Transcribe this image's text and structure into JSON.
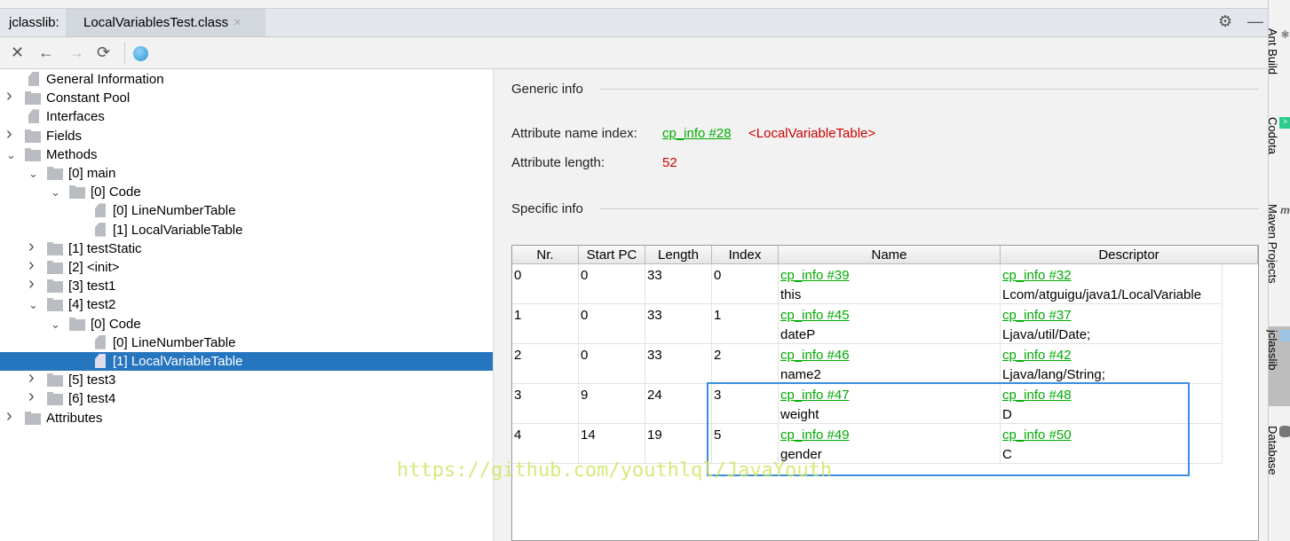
{
  "tabbar": {
    "label": "jclasslib:",
    "tab": "LocalVariablesTest.class",
    "close": "×"
  },
  "toolbar": {
    "close": "✕",
    "back": "←",
    "forward": "→",
    "refresh": "⟳"
  },
  "tree": [
    {
      "label": "General Information",
      "level": 0,
      "type": "file",
      "arrow": ""
    },
    {
      "label": "Constant Pool",
      "level": 0,
      "type": "folder",
      "arrow": "›"
    },
    {
      "label": "Interfaces",
      "level": 0,
      "type": "file",
      "arrow": ""
    },
    {
      "label": "Fields",
      "level": 0,
      "type": "folder",
      "arrow": "›"
    },
    {
      "label": "Methods",
      "level": 0,
      "type": "folder",
      "arrow": "⌄"
    },
    {
      "label": "[0] main",
      "level": 1,
      "type": "folder",
      "arrow": "⌄"
    },
    {
      "label": "[0] Code",
      "level": 2,
      "type": "folder",
      "arrow": "⌄"
    },
    {
      "label": "[0] LineNumberTable",
      "level": 3,
      "type": "file",
      "arrow": ""
    },
    {
      "label": "[1] LocalVariableTable",
      "level": 3,
      "type": "file",
      "arrow": ""
    },
    {
      "label": "[1] testStatic",
      "level": 1,
      "type": "folder",
      "arrow": "›"
    },
    {
      "label": "[2] <init>",
      "level": 1,
      "type": "folder",
      "arrow": "›"
    },
    {
      "label": "[3] test1",
      "level": 1,
      "type": "folder",
      "arrow": "›"
    },
    {
      "label": "[4] test2",
      "level": 1,
      "type": "folder",
      "arrow": "⌄"
    },
    {
      "label": "[0] Code",
      "level": 2,
      "type": "folder",
      "arrow": "⌄"
    },
    {
      "label": "[0] LineNumberTable",
      "level": 3,
      "type": "file",
      "arrow": ""
    },
    {
      "label": "[1] LocalVariableTable",
      "level": 3,
      "type": "file",
      "arrow": "",
      "selected": true
    },
    {
      "label": "[5] test3",
      "level": 1,
      "type": "folder",
      "arrow": "›"
    },
    {
      "label": "[6] test4",
      "level": 1,
      "type": "folder",
      "arrow": "›"
    },
    {
      "label": "Attributes",
      "level": 0,
      "type": "folder",
      "arrow": "›"
    }
  ],
  "generic": {
    "title": "Generic info",
    "name_index_label": "Attribute name index:",
    "name_index_link": "cp_info #28",
    "name_index_value": "<LocalVariableTable>",
    "length_label": "Attribute length:",
    "length_value": "52"
  },
  "specific": {
    "title": "Specific info"
  },
  "table": {
    "headers": [
      "Nr.",
      "Start PC",
      "Length",
      "Index",
      "Name",
      "Descriptor"
    ],
    "rows": [
      [
        "0",
        "0",
        "33",
        "0",
        "cp_info #39",
        "this",
        "cp_info #32",
        "Lcom/atguigu/java1/LocalVariable"
      ],
      [
        "1",
        "0",
        "33",
        "1",
        "cp_info #45",
        "dateP",
        "cp_info #37",
        "Ljava/util/Date;"
      ],
      [
        "2",
        "0",
        "33",
        "2",
        "cp_info #46",
        "name2",
        "cp_info #42",
        "Ljava/lang/String;"
      ],
      [
        "3",
        "9",
        "24",
        "3",
        "cp_info #47",
        "weight",
        "cp_info #48",
        "D"
      ],
      [
        "4",
        "14",
        "19",
        "5",
        "cp_info #49",
        "gender",
        "cp_info #50",
        "C"
      ]
    ]
  },
  "watermark": "https://github.com/youthlql/JavaYouth",
  "sidebar": [
    "Ant Build",
    "Codota",
    "Maven Projects",
    "jclasslib",
    "Database"
  ],
  "colors": {
    "link": "#00aa00",
    "selection": "#2675bf",
    "highlight": "#3a8ee0",
    "value": "#cc0000"
  }
}
